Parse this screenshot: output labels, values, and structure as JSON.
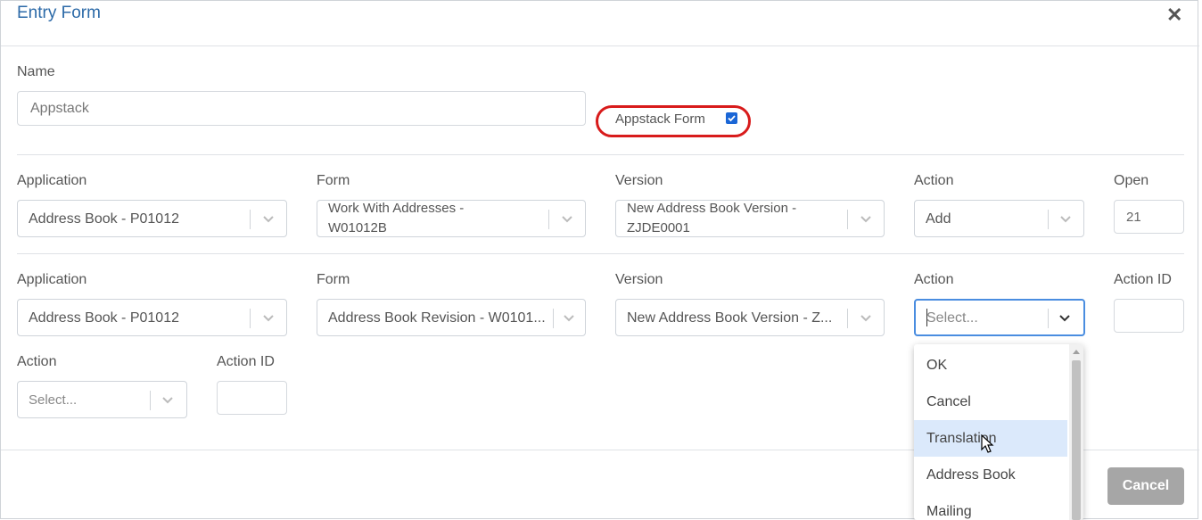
{
  "dialog": {
    "title": "Entry Form",
    "close_glyph": "✕"
  },
  "name_field": {
    "label": "Name",
    "value": "Appstack"
  },
  "appstack_form": {
    "label": "Appstack Form",
    "checked": true
  },
  "row1": {
    "application_label": "Application",
    "application_value": "Address Book - P01012",
    "form_label": "Form",
    "form_value_line1": "Work With Addresses -",
    "form_value_line2": "W01012B",
    "version_label": "Version",
    "version_value_line1": "New Address Book Version -",
    "version_value_line2": "ZJDE0001",
    "action_label": "Action",
    "action_value": "Add",
    "open_label": "Open",
    "open_value": "21"
  },
  "row2": {
    "application_label": "Application",
    "application_value": "Address Book - P01012",
    "form_label": "Form",
    "form_value": "Address Book Revision - W0101...",
    "version_label": "Version",
    "version_value": "New Address Book Version - Z...",
    "action_label": "Action",
    "action_placeholder": "Select...",
    "action_id_label": "Action ID"
  },
  "row3": {
    "action_label": "Action",
    "action_placeholder": "Select...",
    "action_id_label": "Action ID"
  },
  "dropdown": {
    "options": [
      "OK",
      "Cancel",
      "Translation",
      "Address Book",
      "Mailing"
    ],
    "highlighted": "Translation"
  },
  "footer": {
    "cancel_label": "Cancel"
  },
  "colors": {
    "title": "#2c6aa8",
    "primary_button": "#1f5fa8",
    "cancel_button": "#a6a6a6",
    "highlight_ring": "#d81b1b",
    "dropdown_highlight": "#dbe9fb"
  }
}
